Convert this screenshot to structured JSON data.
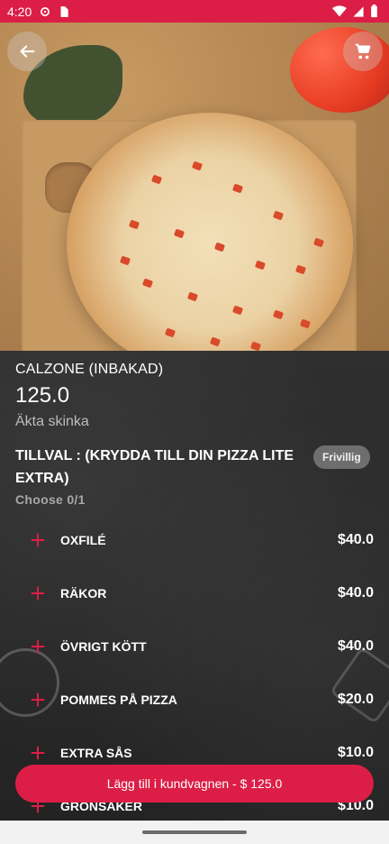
{
  "status_bar": {
    "time": "4:20",
    "left_icons": [
      "settings-gear-icon",
      "sim-card-icon"
    ],
    "right_icons": [
      "wifi-icon",
      "signal-icon",
      "battery-icon"
    ]
  },
  "header": {
    "back_icon": "arrow-left-icon",
    "cart_icon": "shopping-cart-icon"
  },
  "product": {
    "name": "CALZONE (INBAKAD)",
    "price": "125.0",
    "description": "Äkta skinka"
  },
  "extras": {
    "title": "TILLVAL : (KRYDDA TILL DIN PIZZA LITE EXTRA)",
    "badge": "Frivillig",
    "choose_text": "Choose 0/1",
    "items": [
      {
        "label": "OXFILÉ",
        "price": "$40.0"
      },
      {
        "label": "RÄKOR",
        "price": "$40.0"
      },
      {
        "label": "ÖVRIGT KÖTT",
        "price": "$40.0"
      },
      {
        "label": "POMMES PÅ PIZZA",
        "price": "$20.0"
      },
      {
        "label": "EXTRA SÅS",
        "price": "$10.0"
      },
      {
        "label": "GRÖNSAKER",
        "price": "$10.0"
      }
    ]
  },
  "cta": {
    "label": "Lägg till i kundvagnen - $ 125.0"
  },
  "colors": {
    "accent": "#dc1e46",
    "background": "#2b2b2b",
    "badge": "#6e6e6e"
  }
}
